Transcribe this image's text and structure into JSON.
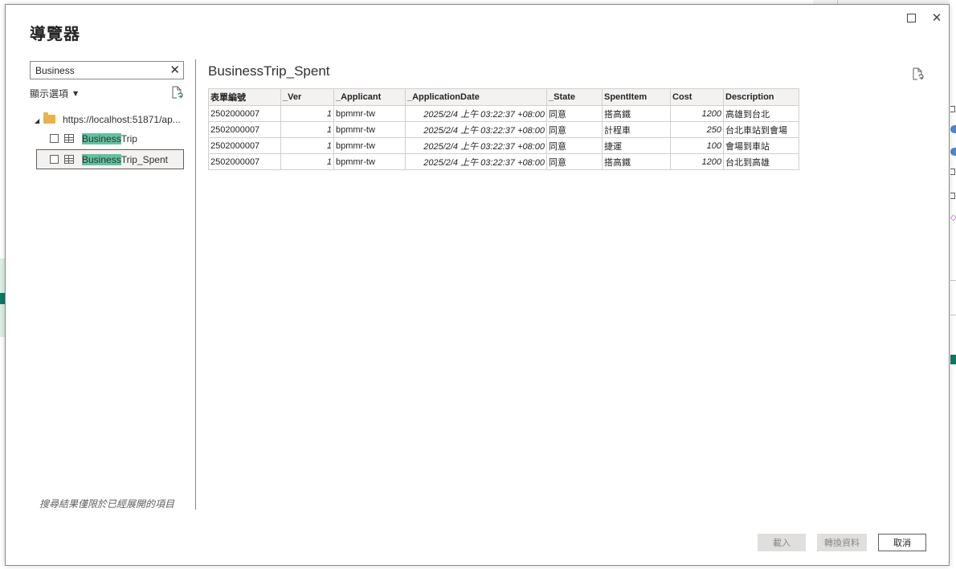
{
  "dialog": {
    "title": "導覽器"
  },
  "left_pane": {
    "search_value": "Business",
    "options_label": "顯示選項",
    "footnote": "搜尋結果僅限於已經展開的項目",
    "tree": {
      "root_label": "https://localhost:51871/ap...",
      "items": [
        {
          "highlight": "Business",
          "rest": "Trip",
          "checked": false,
          "selected": false
        },
        {
          "highlight": "Business",
          "rest": "Trip_Spent",
          "checked": false,
          "selected": true
        }
      ]
    }
  },
  "preview": {
    "title": "BusinessTrip_Spent",
    "columns": [
      "表單編號",
      "_Ver",
      "_Applicant",
      "_ApplicationDate",
      "_State",
      "SpentItem",
      "Cost",
      "Description"
    ],
    "rows": [
      [
        "2502000007",
        "1",
        "bpmmr-tw",
        "2025/2/4 上午 03:22:37 +08:00",
        "同意",
        "搭高鐵",
        "1200",
        "高雄到台北"
      ],
      [
        "2502000007",
        "1",
        "bpmmr-tw",
        "2025/2/4 上午 03:22:37 +08:00",
        "同意",
        "計程車",
        "250",
        "台北車站到會場"
      ],
      [
        "2502000007",
        "1",
        "bpmmr-tw",
        "2025/2/4 上午 03:22:37 +08:00",
        "同意",
        "捷運",
        "100",
        "會場到車站"
      ],
      [
        "2502000007",
        "1",
        "bpmmr-tw",
        "2025/2/4 上午 03:22:37 +08:00",
        "同意",
        "搭高鐵",
        "1200",
        "台北到高雄"
      ]
    ]
  },
  "buttons": {
    "load": "載入",
    "transform": "轉換資料",
    "cancel": "取消"
  },
  "icons": {
    "close": "close-icon",
    "maximize": "maximize-icon",
    "search_clear": "clear-icon",
    "refresh": "refresh-icon",
    "folder": "folder-icon",
    "table": "table-icon"
  }
}
